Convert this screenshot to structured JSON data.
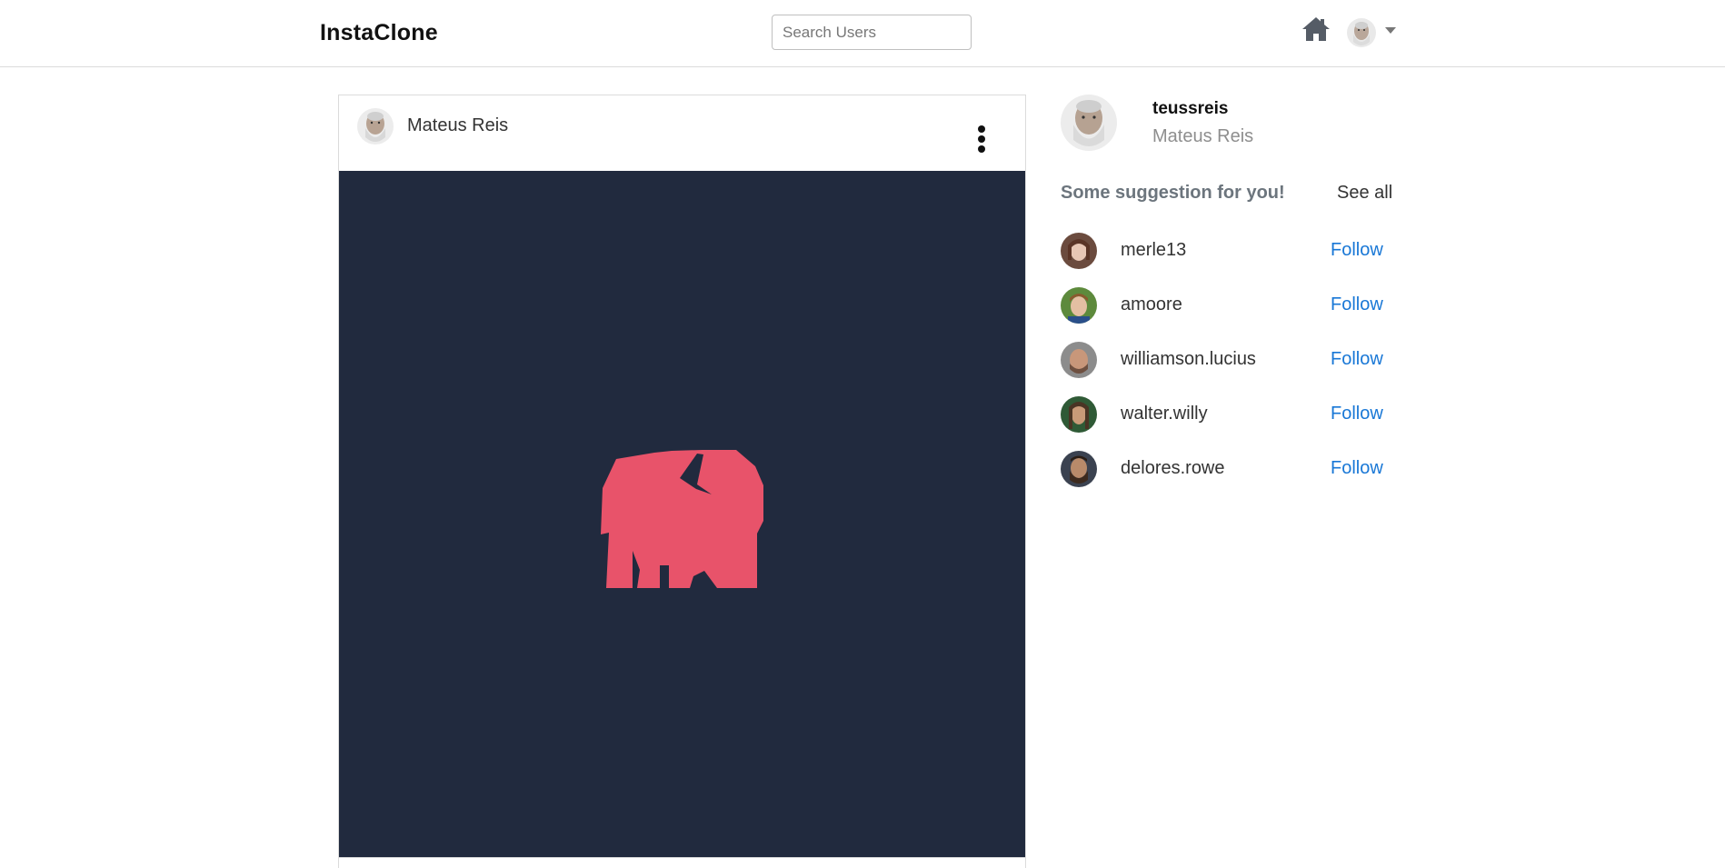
{
  "navbar": {
    "brand": "InstaClone",
    "search_placeholder": "Search Users",
    "search_value": "",
    "home_icon": "home-icon",
    "avatar_icon": "user-avatar",
    "dropdown_icon": "caret-down-icon"
  },
  "post": {
    "author": "Mateus Reis",
    "menu_icon": "vertical-dots-icon",
    "image": {
      "background_color": "#212a3e",
      "logo_color": "#e8536a",
      "logo_icon": "elephant-logo"
    }
  },
  "sidebar": {
    "username": "teussreis",
    "full_name": "Mateus Reis",
    "suggest_title": "Some suggestion for you!",
    "see_all": "See all",
    "suggestions": [
      {
        "username": "merle13",
        "follow": "Follow"
      },
      {
        "username": "amoore",
        "follow": "Follow"
      },
      {
        "username": "williamson.lucius",
        "follow": "Follow"
      },
      {
        "username": "walter.willy",
        "follow": "Follow"
      },
      {
        "username": "delores.rowe",
        "follow": "Follow"
      }
    ]
  },
  "colors": {
    "link": "#1877d6",
    "muted": "#6c757d",
    "border": "#dbdbdb"
  }
}
